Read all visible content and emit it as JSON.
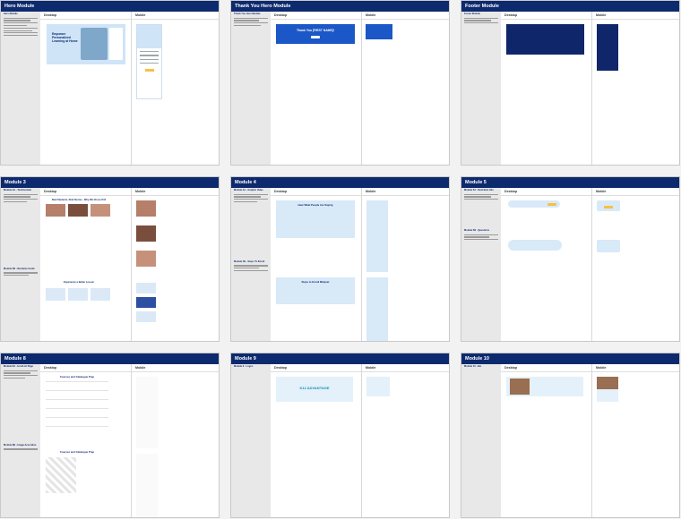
{
  "panels": [
    {
      "title": "Hero Module",
      "desktop": "Desktop",
      "mobile": "Mobile",
      "notes": [
        "Hero Module"
      ],
      "hero_heading": "Empower Personalized Learning at Home"
    },
    {
      "title": "Thank You Hero Module",
      "desktop": "Desktop",
      "mobile": "Mobile",
      "notes": [
        "Thank You Hero Module"
      ],
      "banner": "Thank You [FIRST NAME]!"
    },
    {
      "title": "Footer Module",
      "desktop": "Desktop",
      "mobile": "Mobile",
      "notes": [
        "Footer Module"
      ]
    },
    {
      "title": "Module 3",
      "desktop": "Desktop",
      "mobile": "Mobile",
      "notes": [
        "Module 3A - Testimonials",
        "Module 3B - Narrative Cards"
      ],
      "heading_a": "Real Students, Real Stories - Why We Chose K12",
      "heading_b": "Experience a Better Lesson"
    },
    {
      "title": "Module 4",
      "desktop": "Desktop",
      "mobile": "Mobile",
      "notes": [
        "Module 4A - Graphic Value",
        "Module 4B - Steps To Enroll"
      ],
      "heading_a": "Hear What People Are Saying",
      "heading_b": "Steps to Enroll Midyear"
    },
    {
      "title": "Module 5",
      "desktop": "Desktop",
      "mobile": "Mobile",
      "notes": [
        "Module 5A - Next Best Info",
        "Module 5B - Questions"
      ]
    },
    {
      "title": "Module 8",
      "desktop": "Desktop",
      "mobile": "Mobile",
      "notes": [
        "Module 8A - Icon/List Page",
        "Module 8B - Image Accordion"
      ],
      "heading_a": "Courses and Catalogue Prep",
      "heading_b": "Courses and Catalogue Prep"
    },
    {
      "title": "Module 9",
      "desktop": "Desktop",
      "mobile": "Mobile",
      "notes": [
        "Module 9 - Logos"
      ],
      "logo": "K12 ADVANTAGE"
    },
    {
      "title": "Module 10",
      "desktop": "Desktop",
      "mobile": "Mobile",
      "notes": [
        "Module 10 - Bio"
      ]
    }
  ]
}
